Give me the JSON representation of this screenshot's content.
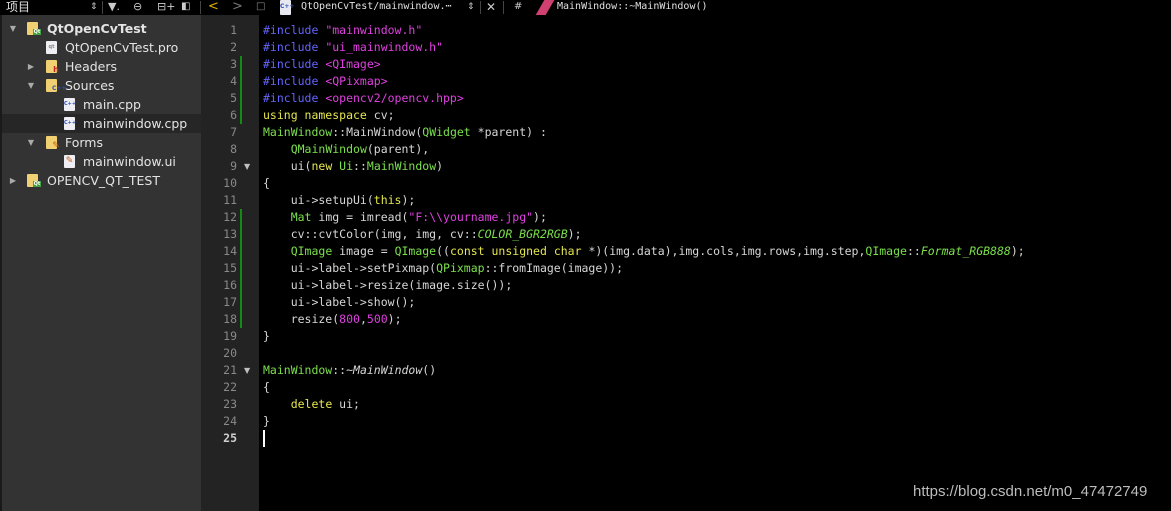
{
  "toolbar": {
    "panel_title": "项目",
    "updown_icon": "⇕",
    "filter_icon": "▼.",
    "link_icon": "⊖",
    "split_icon": "⊟+",
    "close_sidebar_icon": "◧",
    "back_icon": "<",
    "forward_icon": ">",
    "lock_icon": "🔓",
    "file_icon": "C++",
    "open_file": "QtOpenCvTest/mainwindow.⋯",
    "file_dropdown_icon": "⇕",
    "close_icon": "✕",
    "hash": "#",
    "current_symbol": "MainWindow::~MainWindow()"
  },
  "sidebar": {
    "items": [
      {
        "label": "QtOpenCvTest",
        "type": "project",
        "expanded": true,
        "bold": true
      },
      {
        "label": "QtOpenCvTest.pro",
        "type": "pro-file"
      },
      {
        "label": "Headers",
        "type": "folder-headers",
        "expanded": false
      },
      {
        "label": "Sources",
        "type": "folder-sources",
        "expanded": true
      },
      {
        "label": "main.cpp",
        "type": "cpp-file"
      },
      {
        "label": "mainwindow.cpp",
        "type": "cpp-file",
        "selected": true
      },
      {
        "label": "Forms",
        "type": "folder-forms",
        "expanded": true
      },
      {
        "label": "mainwindow.ui",
        "type": "ui-file"
      },
      {
        "label": "OPENCV_QT_TEST",
        "type": "project",
        "expanded": false
      }
    ],
    "icons": {
      "qt_badge": "Qt",
      "h_badge": "h",
      "c_badge": "C++",
      "pen_badge": "✎",
      "pro_file": "qt",
      "cpp_file": "C++",
      "ui_file": "✎",
      "arrow_down": "▼",
      "arrow_right": "▶"
    }
  },
  "editor": {
    "current_line": 25,
    "fold_icon": "▼",
    "lines": [
      [
        [
          "pp",
          "#include "
        ],
        [
          "str",
          "\"mainwindow.h\""
        ]
      ],
      [
        [
          "pp",
          "#include "
        ],
        [
          "str",
          "\"ui_mainwindow.h\""
        ]
      ],
      [
        [
          "pp",
          "#include "
        ],
        [
          "str",
          "<QImage>"
        ]
      ],
      [
        [
          "pp",
          "#include "
        ],
        [
          "str",
          "<QPixmap>"
        ]
      ],
      [
        [
          "pp",
          "#include "
        ],
        [
          "str",
          "<opencv2/opencv.hpp>"
        ]
      ],
      [
        [
          "kw",
          "using namespace "
        ],
        [
          "pl",
          "cv;"
        ]
      ],
      [
        [
          "type",
          "MainWindow"
        ],
        [
          "pl",
          "::MainWindow("
        ],
        [
          "type",
          "QWidget"
        ],
        [
          "pl",
          " *parent) :"
        ]
      ],
      [
        [
          "pl",
          "    "
        ],
        [
          "type",
          "QMainWindow"
        ],
        [
          "pl",
          "(parent),"
        ]
      ],
      [
        [
          "pl",
          "    ui("
        ],
        [
          "kw",
          "new "
        ],
        [
          "type",
          "Ui"
        ],
        [
          "pl",
          "::"
        ],
        [
          "type",
          "MainWindow"
        ],
        [
          "pl",
          ")"
        ]
      ],
      [
        [
          "pl",
          "{"
        ]
      ],
      [
        [
          "pl",
          "    ui->setupUi("
        ],
        [
          "kw",
          "this"
        ],
        [
          "pl",
          ");"
        ]
      ],
      [
        [
          "pl",
          "    "
        ],
        [
          "type",
          "Mat"
        ],
        [
          "pl",
          " img = imread("
        ],
        [
          "str",
          "\"F:\\\\yourname.jpg\""
        ],
        [
          "pl",
          ");"
        ]
      ],
      [
        [
          "pl",
          "    cv::cvtColor(img, img, cv::"
        ],
        [
          "it",
          "COLOR_BGR2RGB"
        ],
        [
          "pl",
          ");"
        ]
      ],
      [
        [
          "pl",
          "    "
        ],
        [
          "type",
          "QImage"
        ],
        [
          "pl",
          " image = "
        ],
        [
          "type",
          "QImage"
        ],
        [
          "pl",
          "(("
        ],
        [
          "kw",
          "const unsigned char"
        ],
        [
          "pl",
          " *)(img.data),img.cols,img.rows,img.step,"
        ],
        [
          "type",
          "QImage"
        ],
        [
          "pl",
          "::"
        ],
        [
          "it",
          "Format_RGB888"
        ],
        [
          "pl",
          ");"
        ]
      ],
      [
        [
          "pl",
          "    ui->label->setPixmap("
        ],
        [
          "type",
          "QPixmap"
        ],
        [
          "pl",
          "::fromImage(image));"
        ]
      ],
      [
        [
          "pl",
          "    ui->label->resize(image.size());"
        ]
      ],
      [
        [
          "pl",
          "    ui->label->show();"
        ]
      ],
      [
        [
          "pl",
          "    resize("
        ],
        [
          "num",
          "800"
        ],
        [
          "pl",
          ","
        ],
        [
          "num",
          "500"
        ],
        [
          "pl",
          ");"
        ]
      ],
      [
        [
          "pl",
          "}"
        ]
      ],
      [],
      [
        [
          "type",
          "MainWindow"
        ],
        [
          "pl",
          "::~"
        ],
        [
          "fit",
          "MainWindow"
        ],
        [
          "pl",
          "()"
        ]
      ],
      [
        [
          "pl",
          "{"
        ]
      ],
      [
        [
          "pl",
          "    "
        ],
        [
          "kw",
          "delete"
        ],
        [
          "pl",
          " ui;"
        ]
      ],
      [
        [
          "pl",
          "}"
        ]
      ],
      []
    ],
    "changed_ranges": [
      [
        3,
        6
      ],
      [
        12,
        18
      ]
    ],
    "fold_lines": [
      9,
      21
    ]
  },
  "watermark": "https://blog.csdn.net/m0_47472749"
}
